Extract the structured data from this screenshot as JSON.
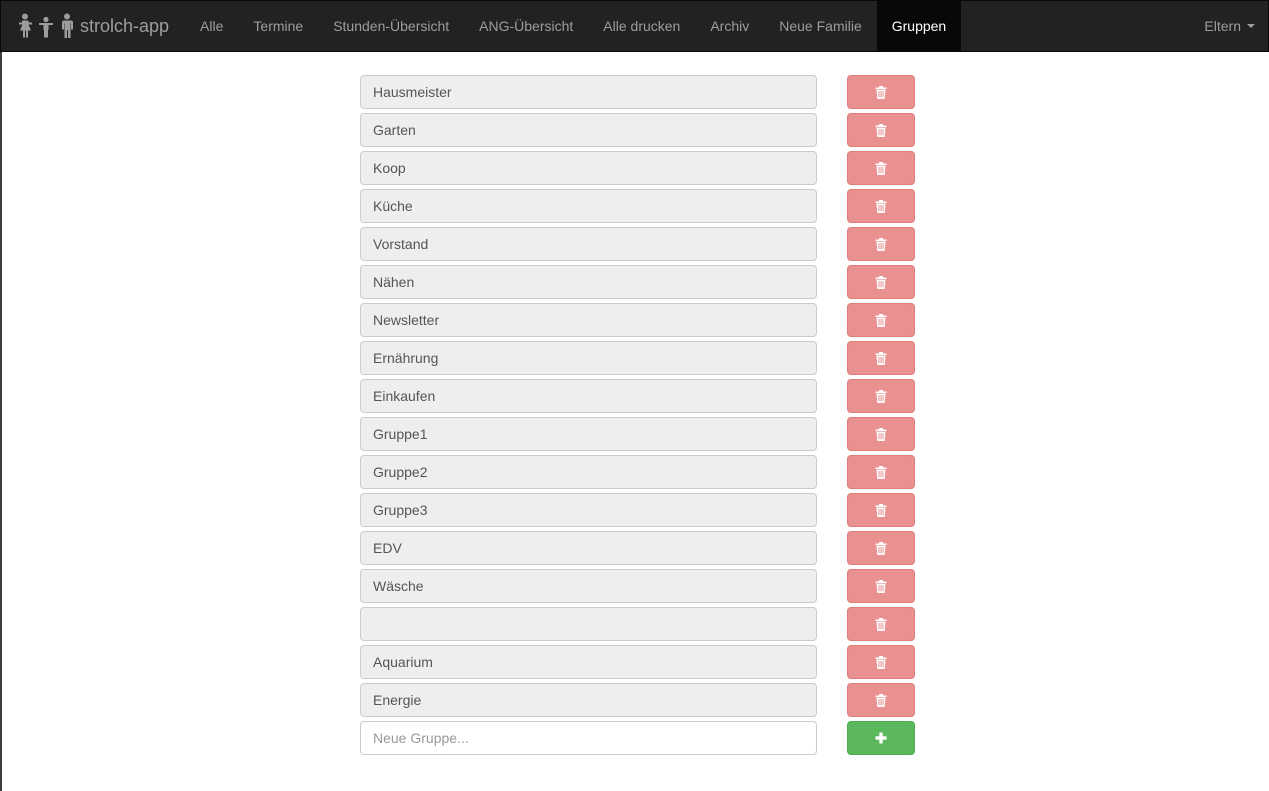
{
  "navbar": {
    "brand_label": "strolch-app",
    "brand_icon": "family-icon",
    "items": [
      {
        "label": "Alle",
        "active": false
      },
      {
        "label": "Termine",
        "active": false
      },
      {
        "label": "Stunden-Übersicht",
        "active": false
      },
      {
        "label": "ANG-Übersicht",
        "active": false
      },
      {
        "label": "Alle drucken",
        "active": false
      },
      {
        "label": "Archiv",
        "active": false
      },
      {
        "label": "Neue Familie",
        "active": false
      },
      {
        "label": "Gruppen",
        "active": true
      }
    ],
    "user_menu_label": "Eltern",
    "user_menu_icon": "caret-down-icon"
  },
  "groups": [
    {
      "value": "Hausmeister"
    },
    {
      "value": "Garten"
    },
    {
      "value": "Koop"
    },
    {
      "value": "Küche"
    },
    {
      "value": "Vorstand"
    },
    {
      "value": "Nähen"
    },
    {
      "value": "Newsletter"
    },
    {
      "value": "Ernährung"
    },
    {
      "value": "Einkaufen"
    },
    {
      "value": "Gruppe1"
    },
    {
      "value": "Gruppe2"
    },
    {
      "value": "Gruppe3"
    },
    {
      "value": "EDV"
    },
    {
      "value": "Wäsche"
    },
    {
      "value": ""
    },
    {
      "value": "Aquarium"
    },
    {
      "value": "Energie"
    }
  ],
  "new_group": {
    "value": "",
    "placeholder": "Neue Gruppe..."
  },
  "icons": {
    "delete": "trash-icon",
    "add": "plus-icon"
  },
  "colors": {
    "navbar_bg": "#222222",
    "nav_active_bg": "#080808",
    "delete_button": "#e89190",
    "add_button": "#5cb85c"
  }
}
